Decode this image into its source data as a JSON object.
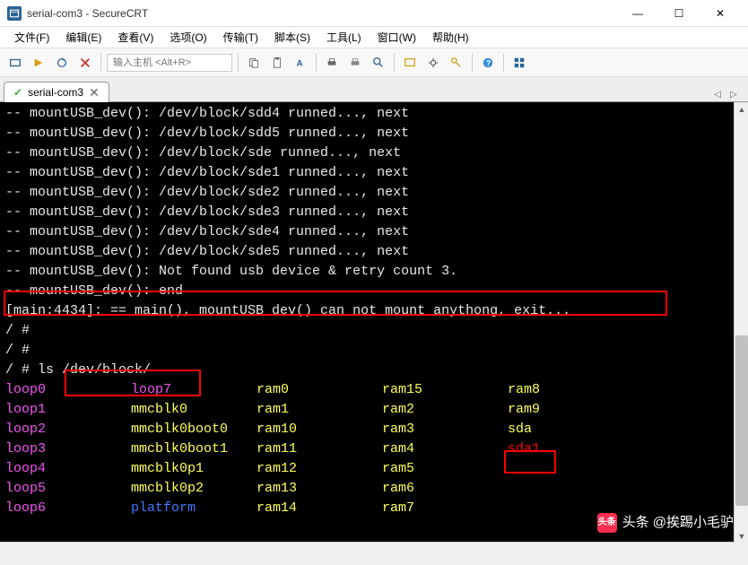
{
  "window": {
    "title": "serial-com3 - SecureCRT",
    "minimize": "—",
    "maximize": "☐",
    "close": "✕"
  },
  "menubar": {
    "file": "文件(F)",
    "edit": "编辑(E)",
    "view": "查看(V)",
    "options": "选项(O)",
    "transfer": "传输(T)",
    "script": "脚本(S)",
    "tools": "工具(L)",
    "window": "窗口(W)",
    "help": "帮助(H)"
  },
  "toolbar": {
    "host_placeholder": "输入主机 <Alt+R>"
  },
  "tab": {
    "name": "serial-com3",
    "check": "✓",
    "close": "✕",
    "left": "◁",
    "right": "▷"
  },
  "terminal": {
    "lines": [
      "-- mountUSB_dev(): /dev/block/sdd4 runned..., next",
      "-- mountUSB_dev(): /dev/block/sdd5 runned..., next",
      "-- mountUSB_dev(): /dev/block/sde runned..., next",
      "-- mountUSB_dev(): /dev/block/sde1 runned..., next",
      "-- mountUSB_dev(): /dev/block/sde2 runned..., next",
      "-- mountUSB_dev(): /dev/block/sde3 runned..., next",
      "-- mountUSB_dev(): /dev/block/sde4 runned..., next",
      "-- mountUSB_dev(): /dev/block/sde5 runned..., next",
      "-- mountUSB_dev(): Not found usb device & retry count 3.",
      "-- mountUSB_dev(): end",
      "[main:4434]: == main(), mountUSB_dev() can not mount anythong, exit...",
      "",
      "/ #",
      "/ #",
      "/ # ls /dev/block/"
    ],
    "ls_grid": [
      [
        {
          "t": "loop0",
          "c": "purple"
        },
        {
          "t": "loop7",
          "c": "purple"
        },
        {
          "t": "ram0",
          "c": "yellow"
        },
        {
          "t": "ram15",
          "c": "yellow"
        },
        {
          "t": "ram8",
          "c": "yellow"
        }
      ],
      [
        {
          "t": "loop1",
          "c": "purple"
        },
        {
          "t": "mmcblk0",
          "c": "yellow"
        },
        {
          "t": "ram1",
          "c": "yellow"
        },
        {
          "t": "ram2",
          "c": "yellow"
        },
        {
          "t": "ram9",
          "c": "yellow"
        }
      ],
      [
        {
          "t": "loop2",
          "c": "purple"
        },
        {
          "t": "mmcblk0boot0",
          "c": "yellow"
        },
        {
          "t": "ram10",
          "c": "yellow"
        },
        {
          "t": "ram3",
          "c": "yellow"
        },
        {
          "t": "sda",
          "c": "yellow"
        }
      ],
      [
        {
          "t": "loop3",
          "c": "purple"
        },
        {
          "t": "mmcblk0boot1",
          "c": "yellow"
        },
        {
          "t": "ram11",
          "c": "yellow"
        },
        {
          "t": "ram4",
          "c": "yellow"
        },
        {
          "t": "sda1",
          "c": "red"
        }
      ],
      [
        {
          "t": "loop4",
          "c": "purple"
        },
        {
          "t": "mmcblk0p1",
          "c": "yellow"
        },
        {
          "t": "ram12",
          "c": "yellow"
        },
        {
          "t": "ram5",
          "c": "yellow"
        },
        {
          "t": "",
          "c": "yellow"
        }
      ],
      [
        {
          "t": "loop5",
          "c": "purple"
        },
        {
          "t": "mmcblk0p2",
          "c": "yellow"
        },
        {
          "t": "ram13",
          "c": "yellow"
        },
        {
          "t": "ram6",
          "c": "yellow"
        },
        {
          "t": "",
          "c": "yellow"
        }
      ],
      [
        {
          "t": "loop6",
          "c": "purple"
        },
        {
          "t": "platform",
          "c": "blue"
        },
        {
          "t": "ram14",
          "c": "yellow"
        },
        {
          "t": "ram7",
          "c": "yellow"
        },
        {
          "t": "",
          "c": "yellow"
        }
      ]
    ]
  },
  "watermark": {
    "text": "头条 @挨踢小毛驴"
  }
}
